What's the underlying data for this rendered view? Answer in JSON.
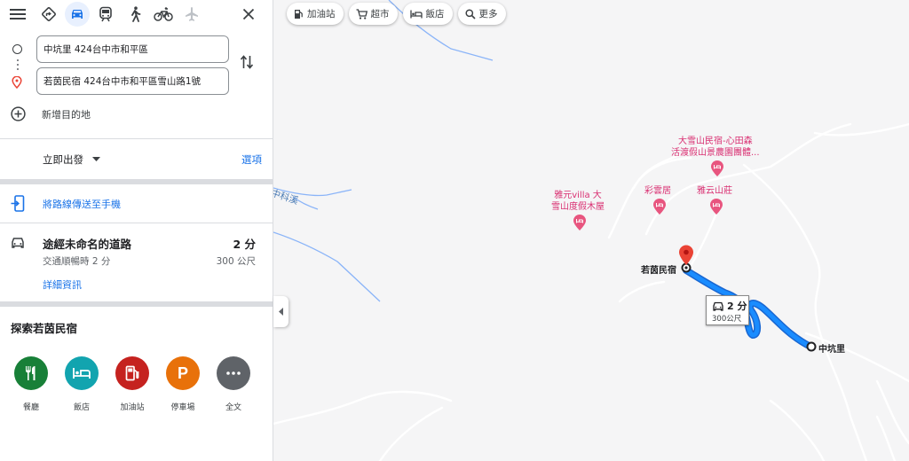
{
  "directions": {
    "origin": "中坑里 424台中市和平區",
    "destination": "若茵民宿 424台中市和平區雪山路1號",
    "add_destination": "新增目的地",
    "depart_label": "立即出發",
    "options_label": "選項",
    "send_to_phone": "將路線傳送至手機",
    "route": {
      "title": "途經未命名的道路",
      "time": "2 分",
      "traffic": "交通順暢時 2 分",
      "distance": "300 公尺",
      "details_link": "詳細資訊"
    }
  },
  "explore": {
    "title": "探索若茵民宿",
    "categories": [
      {
        "label": "餐廳",
        "icon": "restaurant-icon",
        "color": "#188038"
      },
      {
        "label": "飯店",
        "icon": "hotel-icon",
        "color": "#12a4af"
      },
      {
        "label": "加油站",
        "icon": "gas-station-icon",
        "color": "#c5221f"
      },
      {
        "label": "停車場",
        "icon": "parking-icon",
        "color": "#e8710a"
      },
      {
        "label": "全文",
        "icon": "more-icon",
        "color": "#5f6368"
      }
    ]
  },
  "map": {
    "chips": [
      {
        "label": "加油站",
        "icon": "gas-station-icon"
      },
      {
        "label": "超市",
        "icon": "cart-icon"
      },
      {
        "label": "飯店",
        "icon": "hotel-icon"
      },
      {
        "label": "更多",
        "icon": "search-icon"
      }
    ],
    "pois": [
      {
        "line1": "大雪山民宿-心田森",
        "line2": "活渡假山景農園團體..."
      },
      {
        "line1": "雅元villa 大",
        "line2": "雪山度假木屋"
      },
      {
        "line1": "彩雲居",
        "line2": ""
      },
      {
        "line1": "雅云山莊",
        "line2": ""
      }
    ],
    "river_label": "中科溪",
    "start_label": "中坑里",
    "end_label": "若茵民宿",
    "trip": {
      "time": "2 分",
      "distance": "300公尺"
    }
  },
  "colors": {
    "accent": "#1a73e8",
    "route": "#1a8cff",
    "poi": "#d93072",
    "pin": "#ea4335"
  }
}
